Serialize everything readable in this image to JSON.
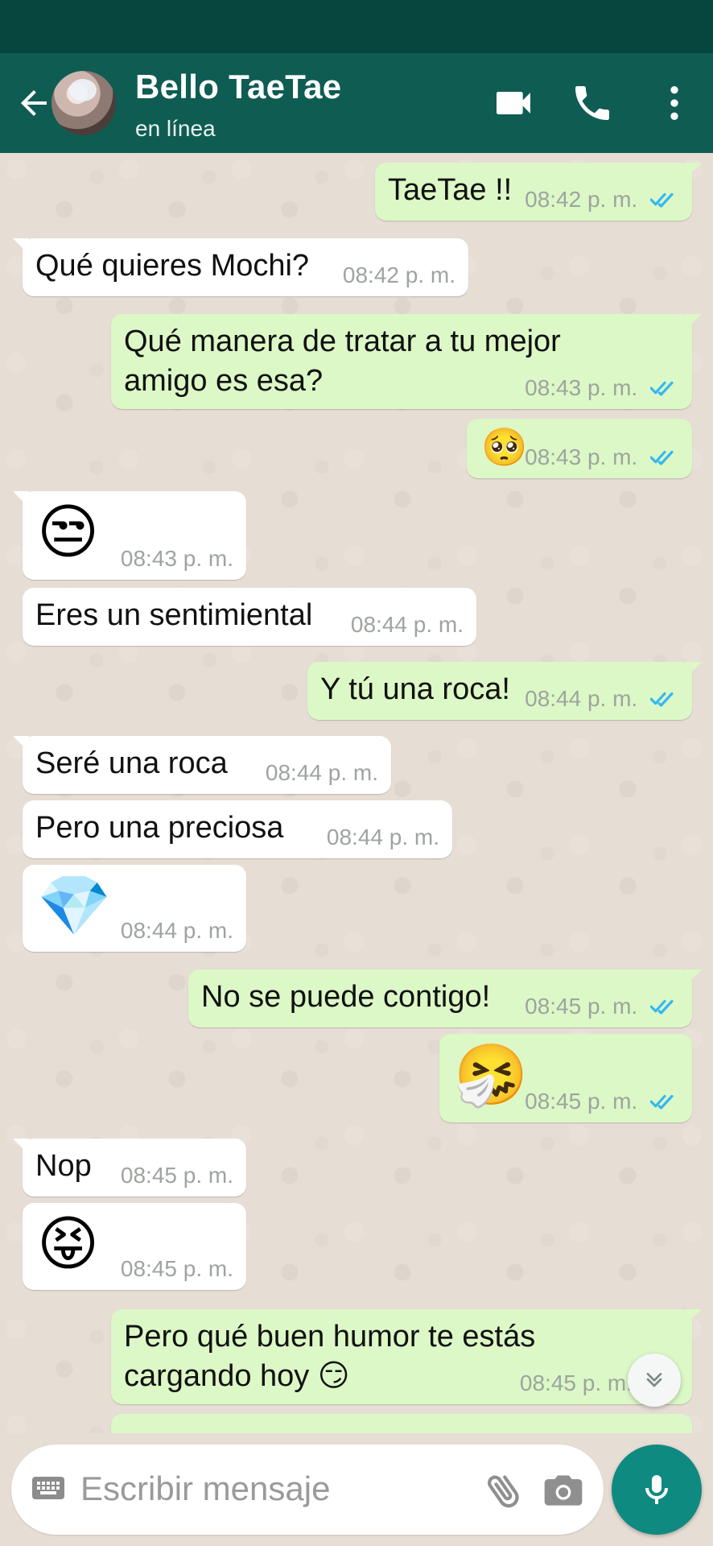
{
  "header": {
    "title": "Bello TaeTae",
    "status": "en línea"
  },
  "messages": [
    {
      "text": "TaeTae !!",
      "time": "08:42 p. m."
    },
    {
      "text": "Qué quieres Mochi?",
      "time": "08:42 p. m."
    },
    {
      "text": "Qué manera de tratar a tu mejor amigo es esa?",
      "time": "08:43 p. m."
    },
    {
      "emoji": "🥺",
      "time": "08:43 p. m."
    },
    {
      "emoji": "😒",
      "time": "08:43 p. m."
    },
    {
      "text": "Eres un sentimiental",
      "time": "08:44 p. m."
    },
    {
      "text": "Y tú una roca!",
      "time": "08:44 p. m."
    },
    {
      "text": "Seré una roca",
      "time": "08:44 p. m."
    },
    {
      "text": "Pero una preciosa",
      "time": "08:44 p. m."
    },
    {
      "emoji": "💎",
      "time": "08:44 p. m."
    },
    {
      "text": "No se puede contigo!",
      "time": "08:45 p. m."
    },
    {
      "emoji": "🤧",
      "time": "08:45 p. m."
    },
    {
      "text": "Nop",
      "time": "08:45 p. m."
    },
    {
      "emoji": "😝",
      "time": "08:45 p. m."
    },
    {
      "text": "Pero qué buen humor te estás cargando hoy 😏",
      "time": "08:45 p. m."
    }
  ],
  "composer": {
    "placeholder": "Escribir mensaje"
  },
  "colors": {
    "header": "#0f5c53",
    "incoming": "#ffffff",
    "outgoing": "#dcf8c6",
    "read_ticks": "#34b7f1",
    "accent": "#0f8a80"
  }
}
